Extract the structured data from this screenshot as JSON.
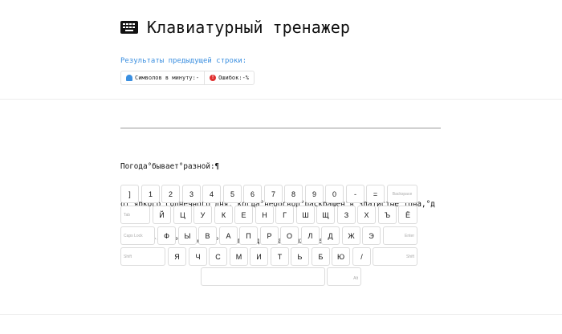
{
  "header": {
    "title": "Клавиатурный тренажер",
    "icon": "keyboard-icon"
  },
  "previous": {
    "label": "Результаты предыдущей строки:",
    "speed": "Символов в минуту:-",
    "errors": "Ошибок:-%",
    "speed_icon": "speedometer-icon",
    "error_icon": "alert-icon"
  },
  "text": {
    "lines": [
      "Погода°бывает°разной:¶",
      "от°яркого°солнечного°дня,°когда°небосвод°раскрашен°в°златистые°тона,°д",
      "о°серых°туч,°нависших°над°городом°как°тяжёлые,°¶"
    ]
  },
  "keyboard": {
    "row1": [
      "]",
      "1",
      "2",
      "3",
      "4",
      "5",
      "6",
      "7",
      "8",
      "9",
      "0",
      "-",
      "=",
      "Backspace"
    ],
    "row2": [
      "Tab",
      "Й",
      "Ц",
      "У",
      "К",
      "Е",
      "Н",
      "Г",
      "Ш",
      "Щ",
      "З",
      "Х",
      "Ъ",
      "Ё"
    ],
    "row3": [
      "Caps Lock",
      "Ф",
      "Ы",
      "В",
      "А",
      "П",
      "Р",
      "О",
      "Л",
      "Д",
      "Ж",
      "Э",
      "Enter"
    ],
    "row4": [
      "Shift",
      "Я",
      "Ч",
      "С",
      "М",
      "И",
      "Т",
      "Ь",
      "Б",
      "Ю",
      "/",
      "Shift"
    ],
    "row5": [
      "",
      "Alt"
    ]
  }
}
